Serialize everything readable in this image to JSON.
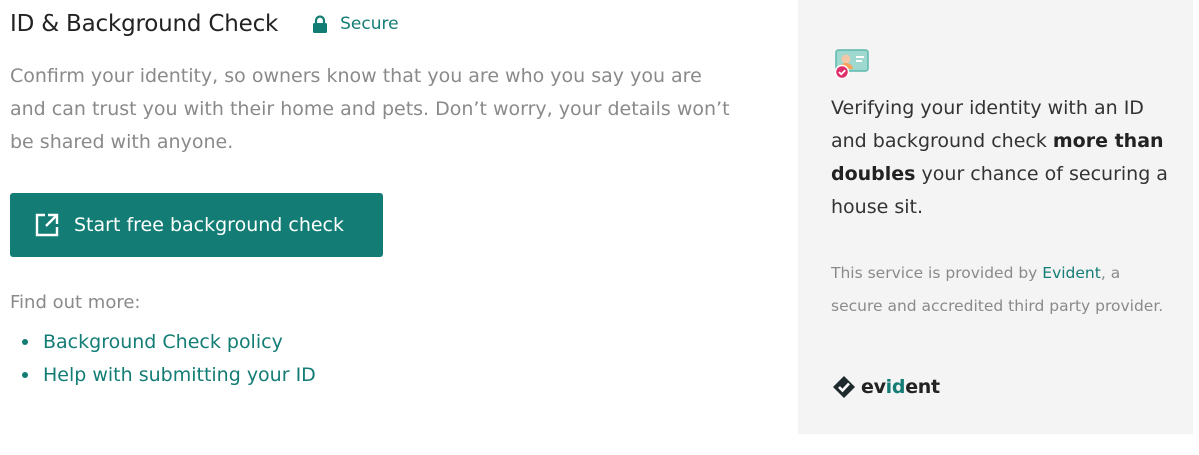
{
  "header": {
    "title": "ID & Background Check",
    "secure_label": "Secure"
  },
  "intro": {
    "text": "Confirm your identity, so owners know that you are who you say you are and can trust you with their home and pets. Don’t worry, your details won’t be shared with anyone."
  },
  "cta": {
    "label": "Start free background check"
  },
  "find_more": {
    "label": "Find out more:",
    "links": [
      {
        "label": "Background Check policy"
      },
      {
        "label": "Help with submitting your ID"
      }
    ]
  },
  "panel": {
    "headline_part1": "Verifying your identity with an ID and background check ",
    "headline_bold": "more than doubles",
    "headline_part2": " your chance of securing a house sit.",
    "provider_prefix": "This service is provided by ",
    "provider_link": "Evident",
    "provider_suffix": ", a secure and accredited third party provider.",
    "logo_text_1": "ev",
    "logo_text_2": "id",
    "logo_text_3": "ent"
  },
  "colors": {
    "accent": "#137d75",
    "panel_bg": "#f4f4f4",
    "muted_text": "#8a8a8a"
  },
  "icons": {
    "secure": "lock-icon",
    "cta": "external-link-icon",
    "panel": "id-card-icon",
    "logo": "evident-check-icon"
  }
}
